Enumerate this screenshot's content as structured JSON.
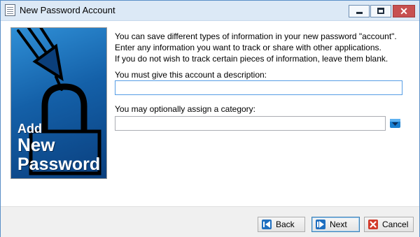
{
  "window": {
    "title": "New Password Account"
  },
  "graphic": {
    "line1": "Add",
    "line2": "New",
    "line3": "Password"
  },
  "intro": {
    "line1": "You can save different types of information in your new password \"account\".",
    "line2": "Enter any information you want to track or share with other applications.",
    "line3": "If you do not wish to track certain pieces of information, leave them blank."
  },
  "form": {
    "description_label": "You must give this account a description:",
    "description_value": "",
    "category_label": "You may optionally assign a category:",
    "category_value": ""
  },
  "buttons": {
    "back": "Back",
    "next": "Next",
    "cancel": "Cancel"
  },
  "colors": {
    "accent": "#1460a8",
    "close": "#c75050"
  },
  "icons": {
    "app": "document-icon",
    "dropdown": "chevron-down-icon",
    "back": "arrow-left-icon",
    "next": "arrow-right-icon",
    "cancel": "x-icon"
  }
}
